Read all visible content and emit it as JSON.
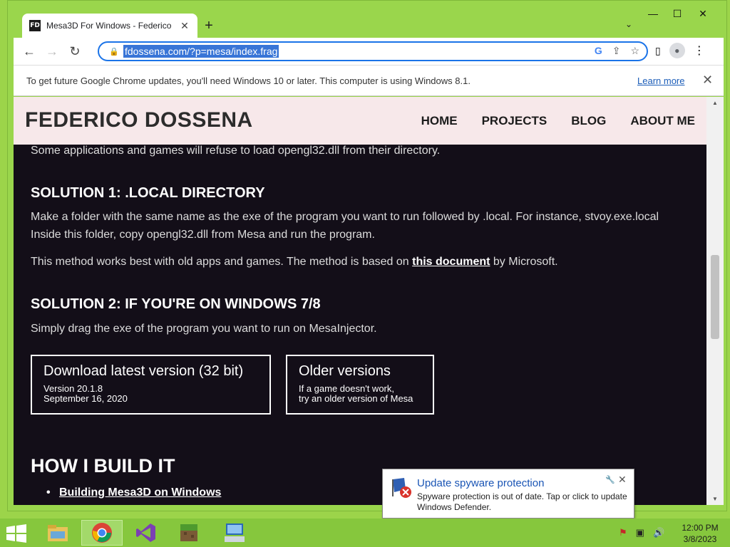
{
  "browser": {
    "tab_title": "Mesa3D For Windows - Federico",
    "tab_favicon": "FD",
    "url": "fdossena.com/?p=mesa/index.frag",
    "infobar_text": "To get future Google Chrome updates, you'll need Windows 10 or later. This computer is using Windows 8.1.",
    "infobar_link": "Learn more"
  },
  "site": {
    "name": "FEDERICO DOSSENA",
    "nav": [
      "HOME",
      "PROJECTS",
      "BLOG",
      "ABOUT ME"
    ]
  },
  "content": {
    "intro": "Some applications and games will refuse to load opengl32.dll from their directory.",
    "sol1_heading": "SOLUTION 1: .LOCAL DIRECTORY",
    "sol1_p1": "Make a folder with the same name as the exe of the program you want to run followed by .local. For instance, stvoy.exe.local",
    "sol1_p2": "Inside this folder, copy opengl32.dll from Mesa and run the program.",
    "sol1_p3_before": "This method works best with old apps and games. The method is based on ",
    "sol1_p3_link": "this document",
    "sol1_p3_after": " by Microsoft.",
    "sol2_heading": "SOLUTION 2: IF YOU'RE ON WINDOWS 7/8",
    "sol2_p1": "Simply drag the exe of the program you want to run on MesaInjector.",
    "download_title": "Download latest version (32 bit)",
    "download_version": "Version 20.1.8",
    "download_date": "September 16, 2020",
    "older_title": "Older versions",
    "older_line1": "If a game doesn't work,",
    "older_line2": "try an older version of Mesa",
    "build_heading": "HOW I BUILD IT",
    "build_link": "Building Mesa3D on Windows"
  },
  "notification": {
    "title": "Update spyware protection",
    "text": "Spyware protection is out of date. Tap or click to update Windows Defender."
  },
  "taskbar": {
    "time": "12:00 PM",
    "date": "3/8/2023"
  },
  "colors": {
    "desktop": "#9cd44a",
    "page_bg": "#130e18",
    "header_bg": "#f7e8ea",
    "omnibox_border": "#1a73e8"
  }
}
